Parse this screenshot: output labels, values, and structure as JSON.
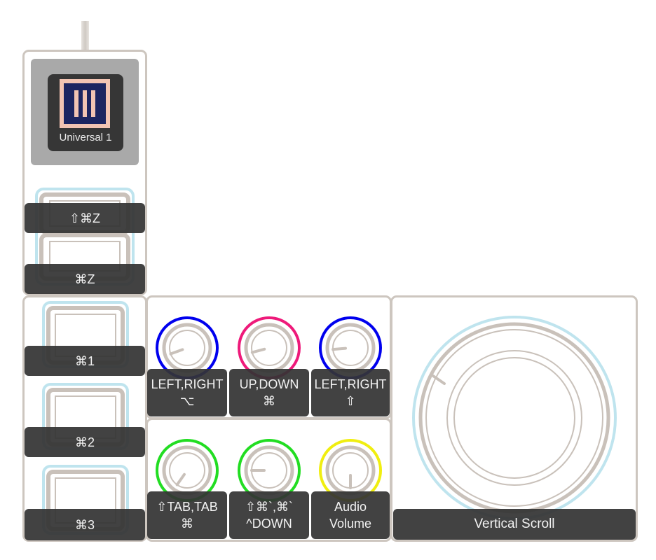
{
  "profile": {
    "name": "Universal 1",
    "icon": "three-bars-icon",
    "colors": {
      "icon_bg": "#1c2561",
      "icon_frame": "#f2c4b3",
      "card_bg": "#363636",
      "tile_bg": "#a9a9a9"
    }
  },
  "keys": [
    {
      "label": "⇧⌘Z"
    },
    {
      "label": "⌘Z"
    },
    {
      "label": "⌘1"
    },
    {
      "label": "⌘2"
    },
    {
      "label": "⌘3"
    }
  ],
  "knobs": [
    {
      "line1": "LEFT,RIGHT",
      "line2": "⌥",
      "ring_color": "#0000ee"
    },
    {
      "line1": "UP,DOWN",
      "line2": "⌘",
      "ring_color": "#ee1a7a"
    },
    {
      "line1": "LEFT,RIGHT",
      "line2": "⇧",
      "ring_color": "#0000ee"
    },
    {
      "line1": "⇧TAB,TAB",
      "line2": "⌘",
      "ring_color": "#22dd22"
    },
    {
      "line1": "⇧⌘`,⌘`",
      "line2": "^DOWN",
      "ring_color": "#22dd22"
    },
    {
      "line1": "Audio",
      "line2": "Volume",
      "ring_color": "#f0ee10"
    }
  ],
  "dial": {
    "label": "Vertical Scroll",
    "ring_color": "#bfe4ee"
  },
  "colors": {
    "panel_border": "#cdc6bf",
    "knob_gray": "#c9c1ba",
    "label_bg": "#343434",
    "key_glow": "#bfe4ee"
  }
}
